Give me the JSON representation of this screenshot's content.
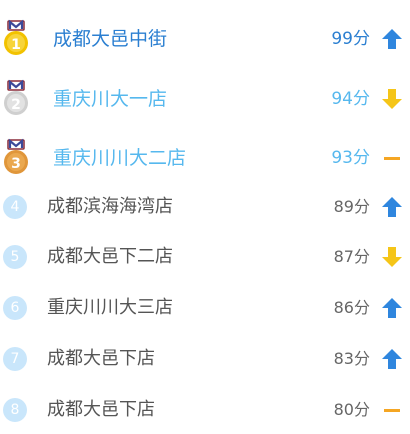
{
  "colors": {
    "gold_name": "#2b7fd1",
    "silver_name": "#56b8ee",
    "bronze_name": "#56b8ee",
    "normal_name": "#555555",
    "up": "#2f86de",
    "down": "#f5c518",
    "flat": "#f5a623",
    "rank_circle": "#c9e6fb"
  },
  "ranking": [
    {
      "rank": "1",
      "name": "成都大邑中街",
      "score": "99分",
      "trend": "up",
      "medal": "gold"
    },
    {
      "rank": "2",
      "name": "重庆川大一店",
      "score": "94分",
      "trend": "down",
      "medal": "silver"
    },
    {
      "rank": "3",
      "name": "重庆川川大二店",
      "score": "93分",
      "trend": "flat",
      "medal": "bronze"
    },
    {
      "rank": "4",
      "name": "成都滨海海湾店",
      "score": "89分",
      "trend": "up",
      "medal": null
    },
    {
      "rank": "5",
      "name": "成都大邑下二店",
      "score": "87分",
      "trend": "down",
      "medal": null
    },
    {
      "rank": "6",
      "name": "重庆川川大三店",
      "score": "86分",
      "trend": "up",
      "medal": null
    },
    {
      "rank": "7",
      "name": "成都大邑下店",
      "score": "83分",
      "trend": "up",
      "medal": null
    },
    {
      "rank": "8",
      "name": "成都大邑下店",
      "score": "80分",
      "trend": "flat",
      "medal": null
    }
  ]
}
